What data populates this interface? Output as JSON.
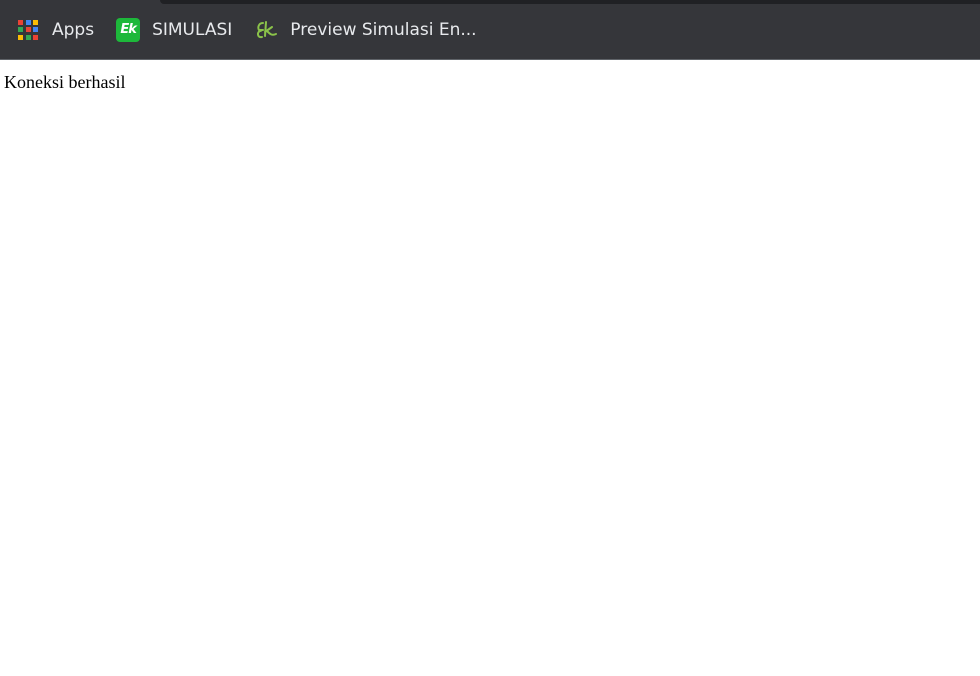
{
  "bookmarks_bar": {
    "items": [
      {
        "label": "Apps",
        "icon": "apps-grid-icon"
      },
      {
        "label": "SIMULASI",
        "icon": "ek-logo-icon",
        "badge_text": "Ek",
        "badge_color": "#1db83a"
      },
      {
        "label": "Preview Simulasi En...",
        "icon": "ek-script-logo-icon",
        "icon_color": "#8bc34a"
      }
    ],
    "apps_grid_colors": [
      "#ea4335",
      "#4285f4",
      "#fbbc05",
      "#34a853",
      "#ea4335",
      "#4285f4",
      "#fbbc05",
      "#34a853",
      "#ea4335"
    ]
  },
  "page": {
    "message": "Koneksi berhasil"
  },
  "colors": {
    "chrome_background": "#35363a",
    "chrome_text": "#e8eaed",
    "page_background": "#ffffff"
  }
}
